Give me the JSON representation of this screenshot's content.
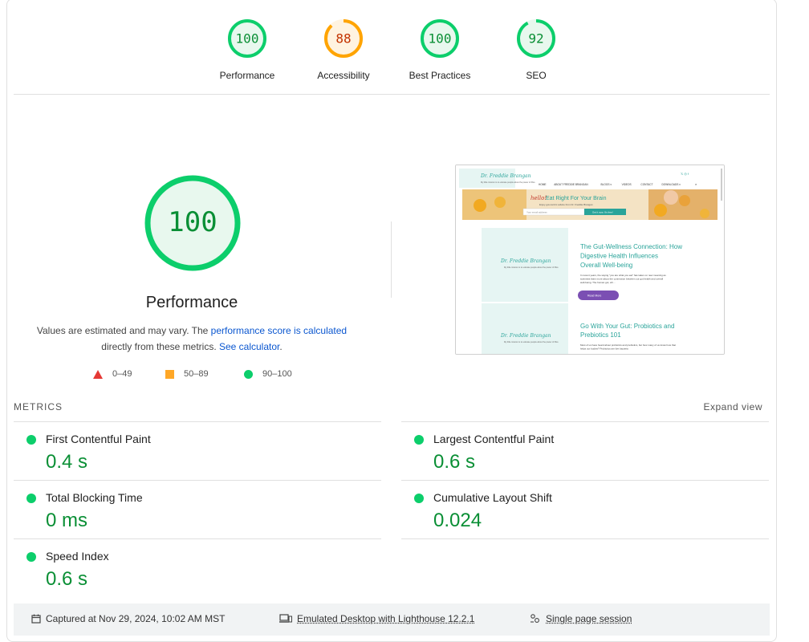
{
  "gauges": [
    {
      "score": "100",
      "label": "Performance",
      "color": "#0cce6b",
      "fill": "#e8f8ee",
      "text_color": "#0a8f35",
      "value": 100
    },
    {
      "score": "88",
      "label": "Accessibility",
      "color": "#ffa400",
      "fill": "#fff3e0",
      "text_color": "#c33300",
      "value": 88
    },
    {
      "score": "100",
      "label": "Best Practices",
      "color": "#0cce6b",
      "fill": "#e8f8ee",
      "text_color": "#0a8f35",
      "value": 100
    },
    {
      "score": "92",
      "label": "SEO",
      "color": "#0cce6b",
      "fill": "#e8f8ee",
      "text_color": "#0a8f35",
      "value": 92
    }
  ],
  "main": {
    "score": "100",
    "title": "Performance",
    "desc_prefix": "Values are estimated and may vary. The ",
    "desc_link1": "performance score is calculated",
    "desc_middle": " directly from these metrics. ",
    "desc_link2": "See calculator",
    "desc_suffix": "."
  },
  "legend": [
    {
      "range": "0–49",
      "shape": "triangle",
      "color": "#e53935"
    },
    {
      "range": "50–89",
      "shape": "square",
      "color": "#ffa726"
    },
    {
      "range": "90–100",
      "shape": "circle",
      "color": "#0cce6b"
    }
  ],
  "screenshot": {
    "site_name": "Dr. Freddie Brangan",
    "tagline": "My little mission is to educate people about the power of fibre",
    "nav": [
      "HOME",
      "ABOUT FREDDIE BRANGAN",
      "BLOGS ▾",
      "VIDEOS",
      "CONTACT",
      "DOWNLOADS ▾"
    ],
    "hero_hello": "hello!",
    "hero_title": "Eat Right For Your Brain",
    "hero_sub": "Enjoy gut-centric advice from Dr. Freddie Brangan",
    "hero_input": "Your email address",
    "hero_button": "Get it now. It's free!",
    "post1_title": "The Gut-Wellness Connection: How Digestive Health Influences Overall Well-being",
    "post1_body": "In recent years, the saying \"you are what you eat\" has taken on new meaning as scientists learn more about the connection between our gut health and overall well-being. The human gut, wh…",
    "post1_button": "Read More",
    "post2_title": "Go With Your Gut: Probiotics and Prebiotics 101",
    "post2_body": "Most of us have heard about probiotics and prebiotics, but how many of us know how that helps our bodies? Probiotics are live bacteria"
  },
  "metrics": {
    "header": "METRICS",
    "expand_label": "Expand view",
    "items": [
      {
        "name": "First Contentful Paint",
        "value": "0.4 s"
      },
      {
        "name": "Largest Contentful Paint",
        "value": "0.6 s"
      },
      {
        "name": "Total Blocking Time",
        "value": "0 ms"
      },
      {
        "name": "Cumulative Layout Shift",
        "value": "0.024"
      },
      {
        "name": "Speed Index",
        "value": "0.6 s"
      }
    ]
  },
  "footer": {
    "captured": "Captured at Nov 29, 2024, 10:02 AM MST",
    "emulated": "Emulated Desktop with Lighthouse 12.2.1",
    "session": "Single page session"
  }
}
